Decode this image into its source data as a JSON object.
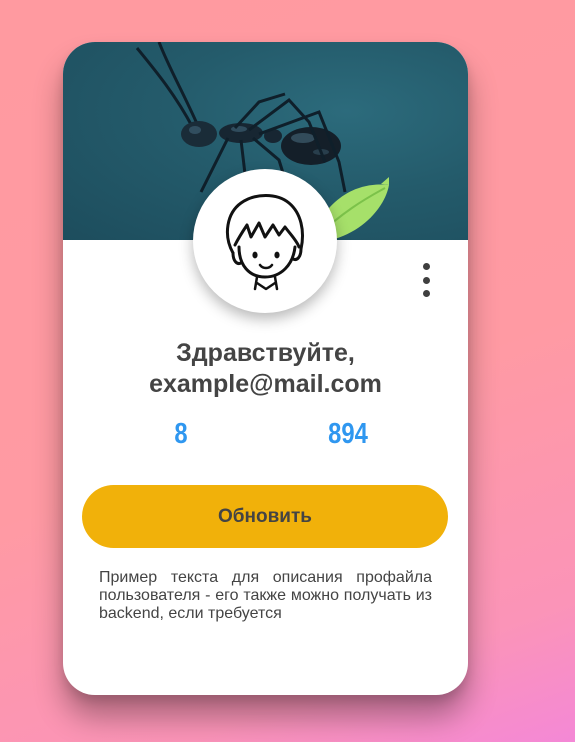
{
  "profile_card": {
    "greeting_line1": "Здравствуйте,",
    "greeting_line2": "example@mail.com",
    "stats": [
      {
        "value": "8"
      },
      {
        "value": "894"
      }
    ],
    "update_button_label": "Обновить",
    "description": "Пример текста для описания профайла пользователя - его также можно получать из backend, если требуется",
    "menu_icon": "more-vertical-icon",
    "avatar_icon": "cartoon-avatar-icon"
  },
  "colors": {
    "accent_button": "#f1b10a",
    "stat_text": "#2f97f0",
    "text": "#444444",
    "cover": "#245b6b"
  }
}
